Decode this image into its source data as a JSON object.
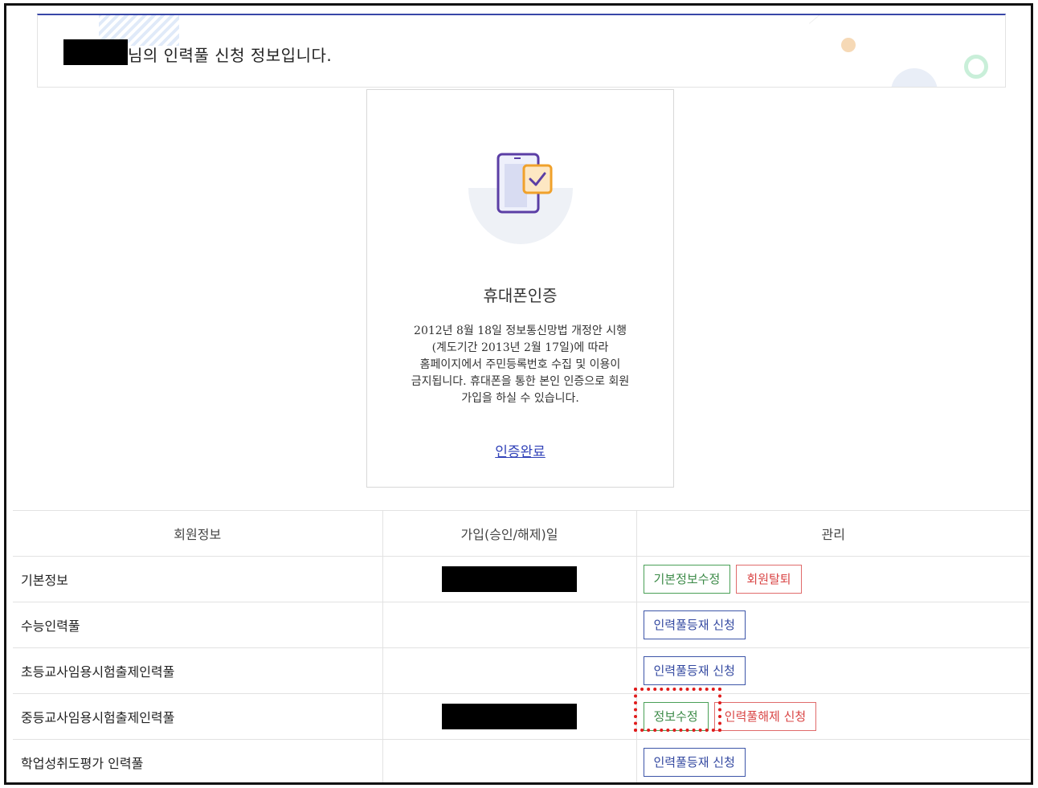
{
  "banner": {
    "title": "님의 인력풀 신청 정보입니다."
  },
  "auth_card": {
    "title": "휴대폰인증",
    "description_lines": [
      "2012년 8월 18일 정보통신망법 개정안 시행",
      "(계도기간 2013년 2월 17일)에 따라",
      "홈페이지에서 주민등록번호 수집 및 이용이",
      "금지됩니다. 휴대폰을 통한 본인 인증으로 회원",
      "가입을 하실 수 있습니다."
    ],
    "link": "인증완료"
  },
  "table": {
    "headers": [
      "회원정보",
      "가입(승인/해제)일",
      "관리"
    ],
    "rows": [
      {
        "name": "기본정보",
        "date_redacted": true,
        "actions": [
          {
            "label": "기본정보수정",
            "style": "green"
          },
          {
            "label": "회원탈퇴",
            "style": "red"
          }
        ]
      },
      {
        "name": "수능인력풀",
        "date_redacted": false,
        "actions": [
          {
            "label": "인력풀등재 신청",
            "style": "blue"
          }
        ]
      },
      {
        "name": "초등교사임용시험출제인력풀",
        "date_redacted": false,
        "actions": [
          {
            "label": "인력풀등재 신청",
            "style": "blue"
          }
        ]
      },
      {
        "name": "중등교사임용시험출제인력풀",
        "date_redacted": true,
        "actions": [
          {
            "label": "정보수정",
            "style": "green"
          },
          {
            "label": "인력풀해제 신청",
            "style": "red"
          }
        ]
      },
      {
        "name": "학업성취도평가 인력풀",
        "date_redacted": false,
        "actions": [
          {
            "label": "인력풀등재 신청",
            "style": "blue"
          }
        ]
      }
    ]
  },
  "colors": {
    "accent_blue": "#3847a8",
    "green": "#4aa057",
    "red": "#e06b6b",
    "highlight": "#e01c1c"
  }
}
